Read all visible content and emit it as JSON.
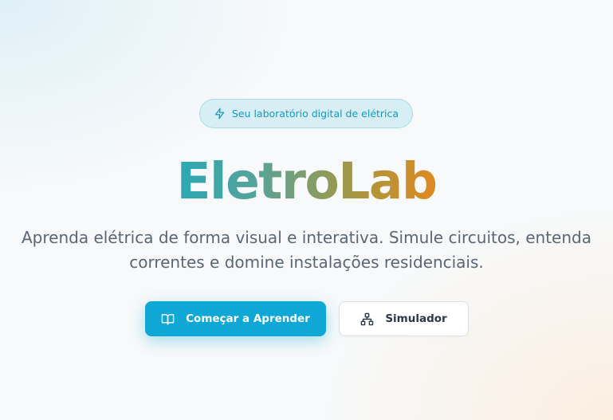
{
  "hero": {
    "badge": {
      "icon": "lightning-icon",
      "label": "Seu laboratório digital de elétrica"
    },
    "title": "EletroLab",
    "subtitle": {
      "line1": "Aprenda elétrica de forma visual e interativa. Simule circuitos, entenda",
      "line2": "correntes e domine instalações residenciais."
    },
    "actions": {
      "primary": {
        "icon": "book-open-icon",
        "label": "Começar a Aprender"
      },
      "secondary": {
        "icon": "network-icon",
        "label": "Simulador"
      }
    }
  },
  "colors": {
    "accent": "#0fa8d6",
    "title_gradient_start": "#2ba8b4",
    "title_gradient_end": "#e08a20",
    "subtitle_text": "#5b6675"
  }
}
